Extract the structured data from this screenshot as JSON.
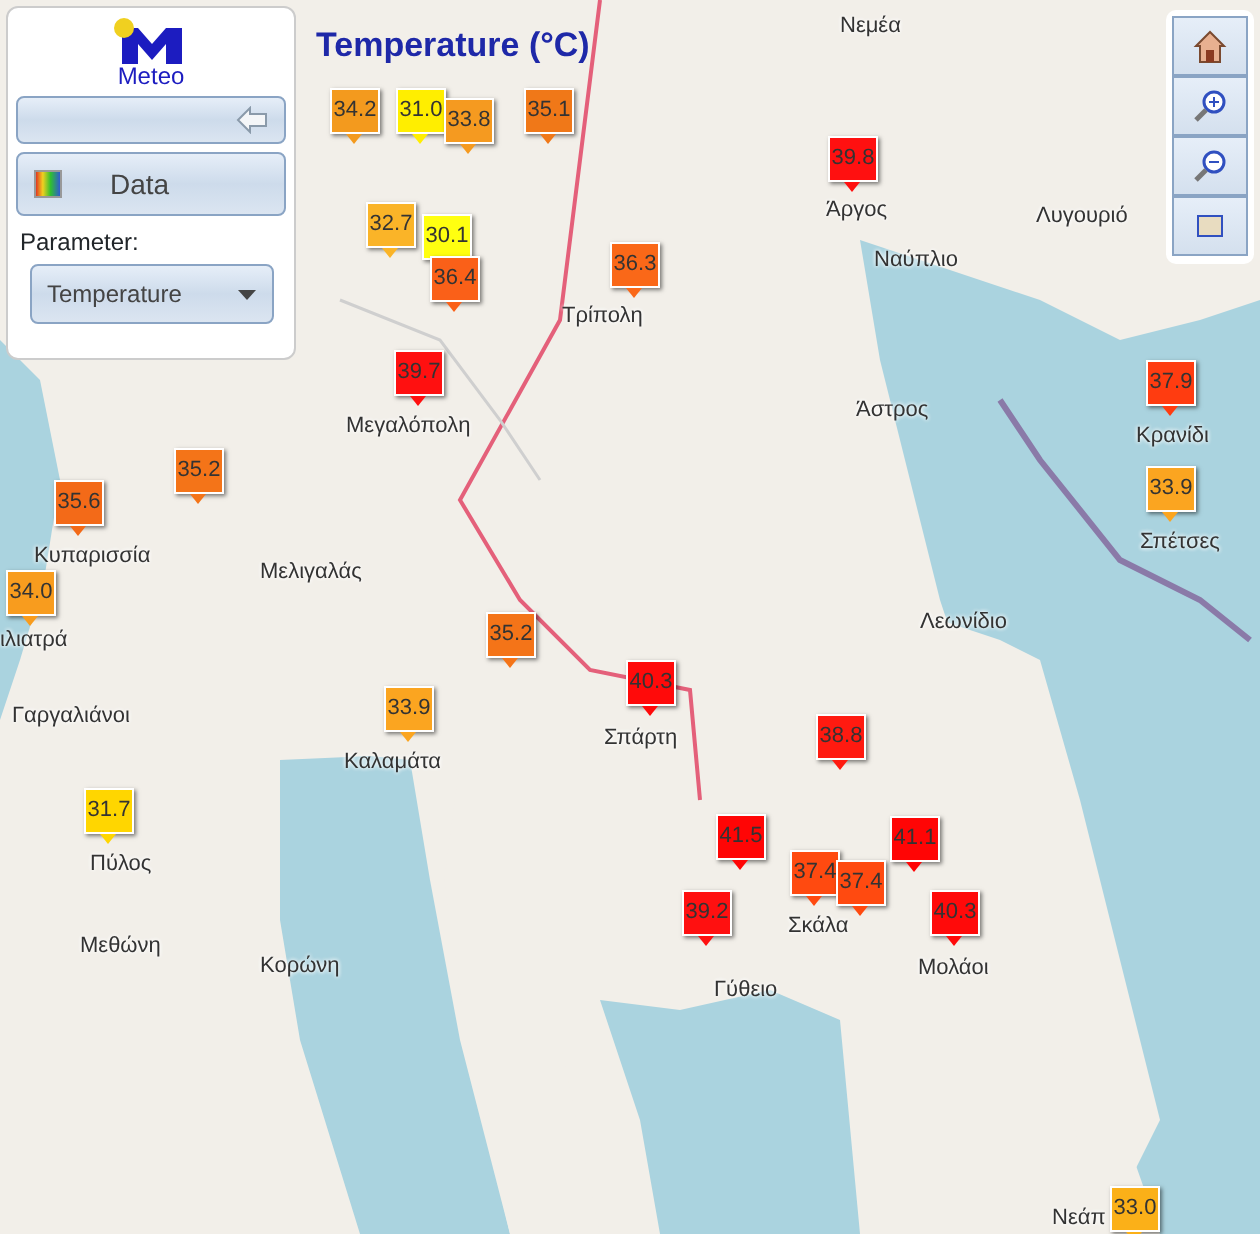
{
  "map_title": "Temperature (°C)",
  "panel": {
    "logo_text": "Meteo",
    "data_button": "Data",
    "parameter_label": "Parameter:",
    "parameter_select": "Temperature"
  },
  "place_labels": [
    "Νεμέα",
    "Άργος",
    "Ναύπλιο",
    "Λυγουριό",
    "Τρίπολη",
    "Άστρος",
    "Κρανίδι",
    "Σπέτσες",
    "Μεγαλόπολη",
    "Κυπαρισσία",
    "Μελιγαλάς",
    "ιλιατρά",
    "Γαργαλιάνοι",
    "Λεωνίδιο",
    "Σπάρτη",
    "Καλαμάτα",
    "Πύλος",
    "Μεθώνη",
    "Κορώνη",
    "Σκάλα",
    "Γύθειο",
    "Μολάοι",
    "Νεάπ"
  ],
  "markers": [
    {
      "value": "34.2",
      "color": "#f39a1e"
    },
    {
      "value": "31.0",
      "color": "#ffee00"
    },
    {
      "value": "33.8",
      "color": "#f59a20"
    },
    {
      "value": "35.1",
      "color": "#f07818"
    },
    {
      "value": "32.7",
      "color": "#fab428"
    },
    {
      "value": "30.1",
      "color": "#ffff10"
    },
    {
      "value": "36.4",
      "color": "#fa6018"
    },
    {
      "value": "39.7",
      "color": "#ff1010"
    },
    {
      "value": "36.3",
      "color": "#fa6818"
    },
    {
      "value": "39.8",
      "color": "#ff1010"
    },
    {
      "value": "37.9",
      "color": "#ff3c10"
    },
    {
      "value": "33.9",
      "color": "#fba520"
    },
    {
      "value": "35.2",
      "color": "#f47418"
    },
    {
      "value": "35.6",
      "color": "#f36a18"
    },
    {
      "value": "34.0",
      "color": "#f89c1e"
    },
    {
      "value": "35.2",
      "color": "#f47418"
    },
    {
      "value": "33.9",
      "color": "#fba520"
    },
    {
      "value": "31.7",
      "color": "#ffd600"
    },
    {
      "value": "40.3",
      "color": "#ff0a0a"
    },
    {
      "value": "38.8",
      "color": "#ff1a10"
    },
    {
      "value": "41.5",
      "color": "#ff0505"
    },
    {
      "value": "37.4",
      "color": "#ff4a10"
    },
    {
      "value": "37.4",
      "color": "#ff4a10"
    },
    {
      "value": "41.1",
      "color": "#ff0505"
    },
    {
      "value": "39.2",
      "color": "#ff1010"
    },
    {
      "value": "40.3",
      "color": "#ff0a0a"
    },
    {
      "value": "33.0",
      "color": "#fbb018"
    }
  ]
}
